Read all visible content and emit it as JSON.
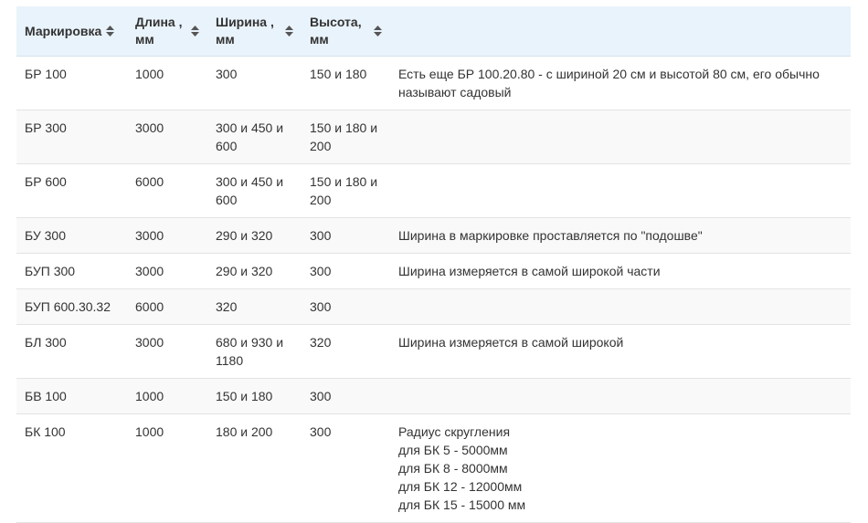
{
  "table": {
    "headers": [
      {
        "label": "Маркировка",
        "sort_icon": "sort-updown-icon"
      },
      {
        "label": "Длина , мм",
        "sort_icon": "sort-updown-icon"
      },
      {
        "label": "Ширина , мм",
        "sort_icon": "sort-updown-icon"
      },
      {
        "label": "Высота, мм",
        "sort_icon": "sort-updown-icon"
      }
    ],
    "rows": [
      {
        "mark": "БР 100",
        "length": "1000",
        "width": "300",
        "height": "150 и 180",
        "note": [
          "Есть еще БР 100.20.80 - с шириной 20 см и высотой 80 см, его обычно называют садовый"
        ]
      },
      {
        "mark": "БР 300",
        "length": "3000",
        "width": "300 и 450 и 600",
        "height": "150 и 180 и 200",
        "note": []
      },
      {
        "mark": "БР 600",
        "length": "6000",
        "width": "300 и 450 и 600",
        "height": "150 и 180 и 200",
        "note": []
      },
      {
        "mark": "БУ 300",
        "length": "3000",
        "width": "290 и 320",
        "height": "300",
        "note": [
          "Ширина в маркировке проставляется по \"подошве\""
        ]
      },
      {
        "mark": "БУП 300",
        "length": "3000",
        "width": "290 и 320",
        "height": "300",
        "note": [
          "Ширина измеряется в самой широкой части"
        ]
      },
      {
        "mark": "БУП 600.30.32",
        "length": "6000",
        "width": "320",
        "height": "300",
        "note": []
      },
      {
        "mark": "БЛ 300",
        "length": "3000",
        "width": "680 и 930 и 1180",
        "height": "320",
        "note": [
          "Ширина измеряется в самой широкой"
        ]
      },
      {
        "mark": "БВ 100",
        "length": "1000",
        "width": "150 и 180",
        "height": "300",
        "note": []
      },
      {
        "mark": "БК 100",
        "length": "1000",
        "width": "180 и 200",
        "height": "300",
        "note": [
          "Радиус скругления",
          "для БК 5 - 5000мм",
          "для БК 8 - 8000мм",
          "для БК 12 - 12000мм",
          "для БК 15 - 15000 мм"
        ]
      }
    ]
  },
  "colors": {
    "header_bg": "#e9f3fb",
    "sort_icon": "#555555",
    "row_alt_bg": "#f9f9f9",
    "border": "#e3e3e3"
  }
}
